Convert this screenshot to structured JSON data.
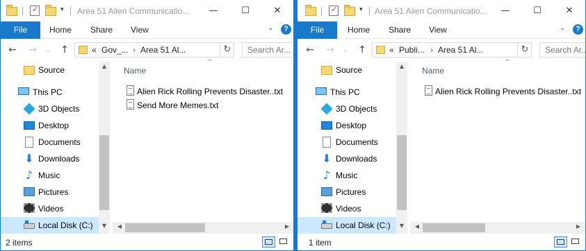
{
  "windows": [
    {
      "title": "Area 51 Alien Communicatio...",
      "ribbon": {
        "file": "File",
        "home": "Home",
        "share": "Share",
        "view": "View",
        "help": "?"
      },
      "address": {
        "prefix": "«",
        "crumb1": "Gov_...",
        "crumb2": "Area 51 Al...",
        "sep": "›"
      },
      "search_placeholder": "Search Ar...",
      "column_header": "Name",
      "files": [
        "Alien Rick Rolling Prevents Disaster..txt",
        "Send More Memes.txt"
      ],
      "status": "2 items"
    },
    {
      "title": "Area 51 Alien Communicatio...",
      "ribbon": {
        "file": "File",
        "home": "Home",
        "share": "Share",
        "view": "View",
        "help": "?"
      },
      "address": {
        "prefix": "«",
        "crumb1": "Publi...",
        "crumb2": "Area 51 Al...",
        "sep": "›"
      },
      "search_placeholder": "Search Ar...",
      "column_header": "Name",
      "files": [
        "Alien Rick Rolling Prevents Disaster..txt"
      ],
      "status": "1 item"
    }
  ],
  "nav": {
    "source": "Source",
    "this_pc": "This PC",
    "objects3d": "3D Objects",
    "desktop": "Desktop",
    "documents": "Documents",
    "downloads": "Downloads",
    "music": "Music",
    "pictures": "Pictures",
    "videos": "Videos",
    "local_disk": "Local Disk (C:)"
  },
  "icons": {
    "back": "←",
    "forward": "→",
    "up": "↑",
    "recent": "⌄",
    "refresh": "↻",
    "minimize": "—",
    "maximize": "☐",
    "close": "✕",
    "chevron": "⌄",
    "sort": "^",
    "scroll_up": "▲",
    "scroll_down": "▼",
    "scroll_left": "◀",
    "scroll_right": "▶",
    "download_arrow": "⬇",
    "music_note": "♪",
    "dropdown": "▾"
  },
  "colors": {
    "accent": "#1979ca",
    "selection": "#cce8ff"
  }
}
